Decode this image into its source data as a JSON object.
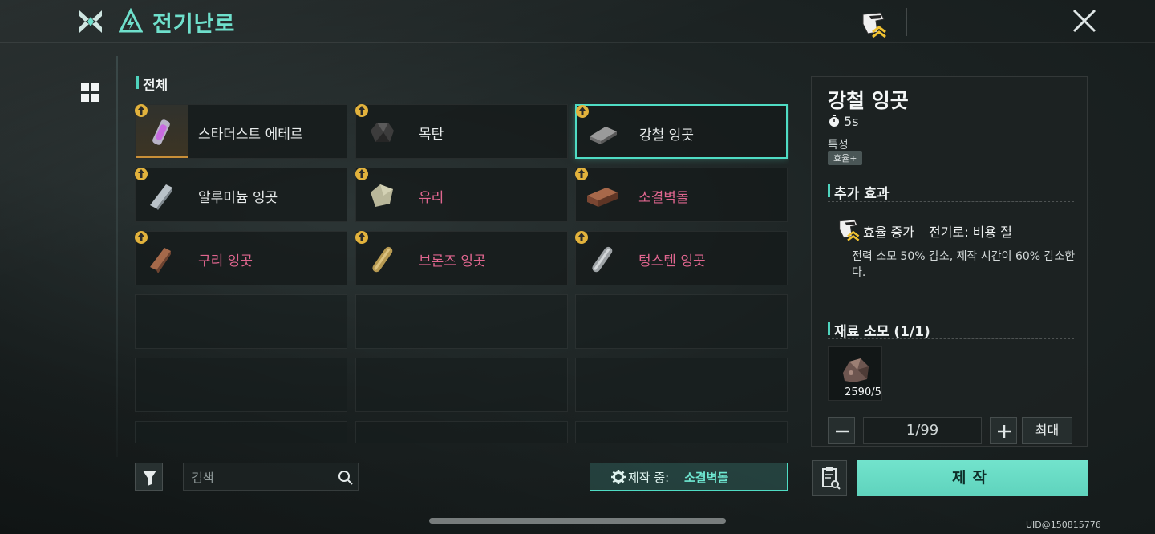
{
  "header": {
    "title": "전기난로",
    "accent": "#6fe0cc"
  },
  "list": {
    "category_label": "전체",
    "items": [
      {
        "name": "스타더스트 에테르",
        "color": "white",
        "rare": true,
        "icon": "ether-vial-icon"
      },
      {
        "name": "목탄",
        "color": "white",
        "icon": "charcoal-icon"
      },
      {
        "name": "강철 잉곳",
        "color": "white",
        "selected": true,
        "icon": "steel-ingot-icon"
      },
      {
        "name": "알루미늄 잉곳",
        "color": "white",
        "icon": "aluminum-ingot-icon"
      },
      {
        "name": "유리",
        "color": "pink",
        "icon": "glass-icon"
      },
      {
        "name": "소결벽돌",
        "color": "pink",
        "icon": "brick-icon"
      },
      {
        "name": "구리 잉곳",
        "color": "pink",
        "icon": "copper-ingot-icon"
      },
      {
        "name": "브론즈 잉곳",
        "color": "pink",
        "icon": "bronze-ingot-icon"
      },
      {
        "name": "텅스텐 잉곳",
        "color": "pink",
        "icon": "tungsten-ingot-icon"
      }
    ]
  },
  "bottom": {
    "search_placeholder": "검색",
    "crafting_label": "제작 중:",
    "crafting_value": "소결벽돌"
  },
  "detail": {
    "title": "강철 잉곳",
    "time": "5s",
    "trait_label": "특성",
    "trait_tag": "효율+",
    "effect_section": "추가 효과",
    "effect_name": "효율 증가",
    "effect_source": "전기로: 비용 절",
    "effect_desc": "전력 소모 50% 감소, 제작 시간이 60% 감소한다.",
    "material_section": "재료 소모 (1/1)",
    "material_count": "2590/5",
    "quantity": "1/99",
    "max_label": "최대",
    "craft_label": "제작"
  },
  "footer": {
    "uid": "UID@150815776"
  },
  "colors": {
    "accent": "#4fdcc4",
    "pink_text": "#e0668f",
    "badge_gold": "#e2b23c"
  }
}
